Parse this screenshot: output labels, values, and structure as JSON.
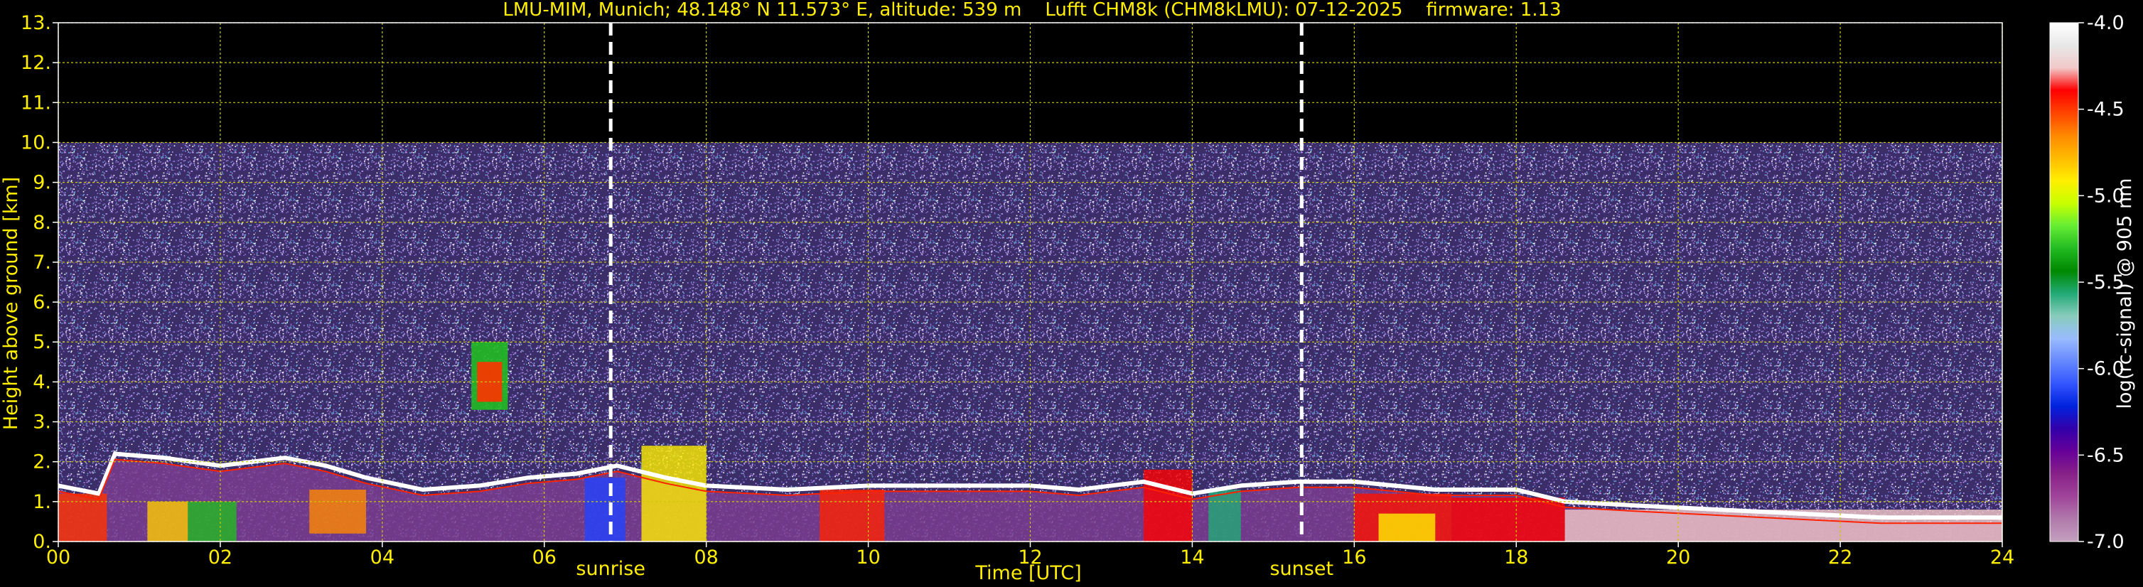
{
  "chart_data": {
    "type": "heatmap",
    "title": "LMU-MIM, Munich; 48.148° N 11.573° E, altitude: 539 m    Lufft CHM8k (CHM8kLMU): 07-12-2025    firmware: 1.13",
    "xlabel": "Time [UTC]",
    "ylabel": "Height above ground [km]",
    "xlim": [
      0,
      24
    ],
    "ylim": [
      0,
      13
    ],
    "x_ticks": [
      "00",
      "02",
      "04",
      "06",
      "08",
      "10",
      "12",
      "14",
      "16",
      "18",
      "20",
      "22",
      "24"
    ],
    "y_ticks": [
      "0.",
      "1.",
      "2.",
      "3.",
      "4.",
      "5.",
      "6.",
      "7.",
      "8.",
      "9.",
      "10.",
      "11.",
      "12.",
      "13."
    ],
    "grid": true,
    "annotations": [
      {
        "text": "sunrise",
        "x": 6.82
      },
      {
        "text": "sunset",
        "x": 15.35
      }
    ],
    "signal_top_km": 10,
    "colorbar": {
      "label": "log(rc-signal) @ 905 nm",
      "range": [
        -7.0,
        -4.0
      ],
      "ticks": [
        "-4.0",
        "-4.5",
        "-5.0",
        "-5.5",
        "-6.0",
        "-6.5",
        "-7.0"
      ],
      "colors": [
        "#ffffff",
        "#e8e8e8",
        "#f2c8c8",
        "#ff0000",
        "#ff4400",
        "#ff8800",
        "#ffbb00",
        "#ffee00",
        "#c8ff00",
        "#66ee33",
        "#22bb22",
        "#008800",
        "#22aa77",
        "#88ccbb",
        "#99bbff",
        "#6688ff",
        "#3355ff",
        "#0022dd",
        "#3300aa",
        "#660099",
        "#882288",
        "#a0449a",
        "#b07aab",
        "#c4a0be"
      ]
    },
    "features": {
      "cloud_base_km": [
        [
          0.0,
          1.4
        ],
        [
          0.5,
          1.2
        ],
        [
          0.7,
          2.2
        ],
        [
          1.3,
          2.1
        ],
        [
          2.0,
          1.9
        ],
        [
          2.8,
          2.1
        ],
        [
          3.3,
          1.9
        ],
        [
          3.8,
          1.6
        ],
        [
          4.5,
          1.3
        ],
        [
          5.2,
          1.4
        ],
        [
          5.8,
          1.6
        ],
        [
          6.4,
          1.7
        ],
        [
          6.9,
          1.9
        ],
        [
          7.5,
          1.6
        ],
        [
          8.0,
          1.4
        ],
        [
          9.0,
          1.3
        ],
        [
          10.0,
          1.4
        ],
        [
          11.0,
          1.4
        ],
        [
          12.0,
          1.4
        ],
        [
          12.6,
          1.3
        ],
        [
          13.4,
          1.5
        ],
        [
          14.0,
          1.2
        ],
        [
          14.6,
          1.4
        ],
        [
          15.3,
          1.5
        ],
        [
          16.0,
          1.5
        ],
        [
          17.0,
          1.3
        ],
        [
          18.0,
          1.3
        ],
        [
          18.6,
          1.0
        ],
        [
          19.5,
          0.9
        ],
        [
          20.5,
          0.8
        ],
        [
          21.5,
          0.7
        ],
        [
          22.5,
          0.6
        ],
        [
          24.0,
          0.6
        ]
      ],
      "elevated_layer": {
        "x": [
          5.1,
          5.55
        ],
        "y": [
          3.3,
          5.0
        ]
      }
    }
  }
}
